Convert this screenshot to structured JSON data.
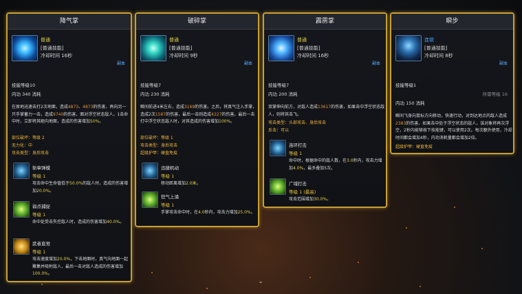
{
  "cards": [
    {
      "title": "降气掌",
      "quality": "普通",
      "type": "[普通技能]",
      "cooldown": "冷却时间 16秒",
      "copy": "副本",
      "level": "技能等级10",
      "mp": "内功 340 消耗",
      "desc": [
        "在原地迅速击打2次地面，造成",
        "4873",
        "、",
        "4873",
        "的伤害，再向",
        "另一只手掌蓄力一击，造成",
        "9740",
        "的伤害，面对浮空状态敌",
        "人，1击命中时，立即将其砸向地面，造成的伤害增加",
        "50%",
        "。"
      ],
      "attrs": [
        {
          "label": "部位破坏：",
          "value": "等级 2"
        },
        {
          "label": "无力化：",
          "value": "中"
        },
        {
          "label": "攻击类型：",
          "value": "身后攻击"
        }
      ],
      "subs": [
        {
          "name": "斩章弹模",
          "level": "等级 1",
          "desc_a": "攻击命中生命值低于",
          "desc_b": "50.0%",
          "desc_c": "的敌人时，造",
          "desc_d": "成的伤害增加",
          "desc_e": "20.0%",
          "desc_f": "。"
        },
        {
          "name": "弱点捕捉",
          "level": "等级 1",
          "desc_a": "命中处受击失控敌人时，造成的伤害增",
          "desc_b": "",
          "desc_c": "",
          "desc_d": "加",
          "desc_e": "40.0%",
          "desc_f": "。"
        },
        {
          "name": "武者直觉",
          "level": "等级 1",
          "desc_a": "攻击速度增加",
          "desc_b": "20.0%",
          "desc_c": "，下击地面时，真气",
          "desc_d": "向地面一起聚集并吸附敌人，最后一击对",
          "desc_e": "敌人造成的伤害增加",
          "desc_f": "100.0%"
        }
      ]
    },
    {
      "title": "破碎掌",
      "quality": "普通",
      "type": "[普通技能]",
      "cooldown": "冷却时间 9秒",
      "copy": "副本",
      "level": "技能等级7",
      "mp": "内功 230 消耗",
      "desc": [
        "瞬间前进4米左右，造成",
        "3169",
        "的伤害。之后，将真气注入手",
        "掌，造成2次",
        "1587",
        "的伤害，最后一击则造成",
        "4227",
        "的伤害。",
        "最后一击打中浮空状态敌人时，对其造成的伤害增加",
        "100%",
        "。"
      ],
      "attrs": [
        {
          "label": "部位破坏：",
          "value": "等级 1"
        },
        {
          "label": "攻击类型：",
          "value": "身后攻击"
        },
        {
          "label": "超级护甲：",
          "value": "硬直免疫"
        }
      ],
      "subs": [
        {
          "name": "迅捷机动",
          "level": "等级 1",
          "desc_a": "移动距离增加",
          "desc_b": "2.0米",
          "desc_c": "。"
        },
        {
          "name": "狂气上涌",
          "level": "等级 1",
          "desc_a": "手掌攻击命中时，在",
          "desc_b": "4.0",
          "desc_c": "秒内，攻击力增",
          "desc_d": "加",
          "desc_e": "25.0%",
          "desc_f": "。"
        }
      ]
    },
    {
      "title": "霹雳掌",
      "quality": "普通",
      "type": "[普通技能]",
      "cooldown": "冷却时间 16秒",
      "copy": "副本",
      "level": "技能等级7",
      "mp": "内功 200 消耗",
      "desc": [
        "双掌伸向前方，对敌人造成",
        "13617",
        "的伤害，如果击中浮空状",
        "态敌人，则将其击飞。"
      ],
      "attrs": [
        {
          "label": "攻击类型：",
          "value": "头部攻击、身后攻击"
        },
        {
          "label": "反击：",
          "value": "可以"
        }
      ],
      "subs": [
        {
          "name": "连环打击",
          "level": "等级 1",
          "desc_a": "命中时，根据命中的敌人数，在",
          "desc_b": "3.0",
          "desc_c": "秒",
          "desc_d": "内，攻击力增加",
          "desc_e": "4.0%",
          "desc_f": "，最多叠加5次。"
        },
        {
          "name": "广域打击",
          "level": "等级 1 (最高)",
          "desc_a": "攻击范围增加",
          "desc_b": "30.0%",
          "desc_c": "。"
        }
      ]
    },
    {
      "title": "瞬步",
      "quality": "连锁",
      "type": "[普通技能]",
      "cooldown": "冷却时间 8秒",
      "copy": "副本",
      "level": "技能等级1",
      "extra": "所需等级 16",
      "mp": "内功 150 消耗",
      "desc": [
        "瞬间飞身向鼠标方向移动，快速行动，对到达地点的敌人造",
        "成",
        "2383",
        "的伤害，如果击中处于浮空状态的敌人，该对象将",
        "再次浮空，2秒内能够按下技能键，可以使用2次。每次额外",
        "使用，冷却时间都会增加4秒，内功消耗量都会增加2倍。"
      ],
      "attrs": [
        {
          "label": "超级护甲：",
          "value": "硬直免疫"
        }
      ]
    }
  ]
}
